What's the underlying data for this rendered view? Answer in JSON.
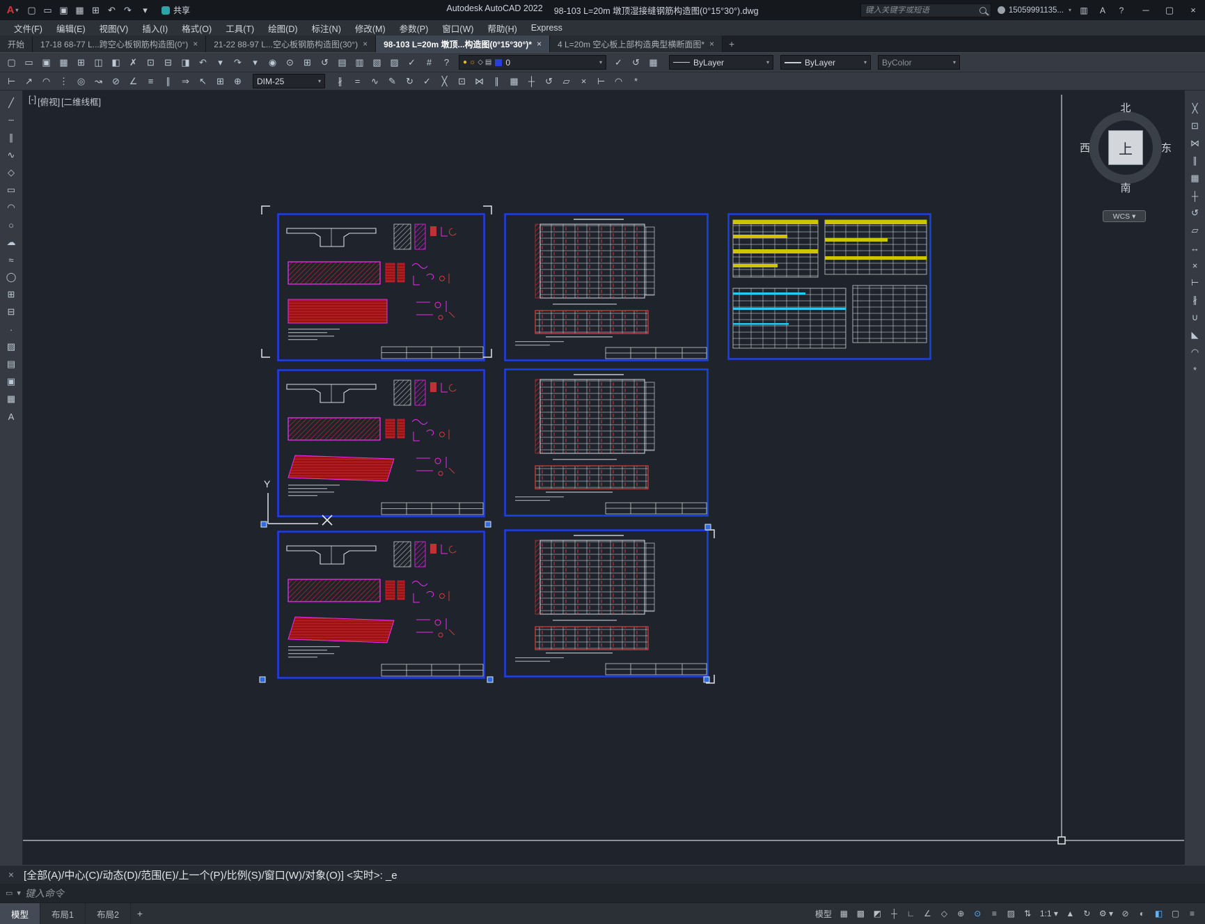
{
  "ui": {
    "caret": "▾"
  },
  "titlebar": {
    "app_title": "Autodesk AutoCAD 2022",
    "doc_title": "98-103 L=20m 墩顶湿接缝钢筋构造图(0°15°30°).dwg",
    "search_placeholder": "键入关键字或短语",
    "user_id": "15059991135...",
    "share_label": "共享",
    "qat_icons": [
      {
        "name": "qnew-icon",
        "glyph": "▢"
      },
      {
        "name": "open-icon",
        "glyph": "▭"
      },
      {
        "name": "save-icon",
        "glyph": "▣"
      },
      {
        "name": "save-as-icon",
        "glyph": "▦"
      },
      {
        "name": "plot-icon",
        "glyph": "⊞"
      },
      {
        "name": "undo-icon",
        "glyph": "↶"
      },
      {
        "name": "redo-icon",
        "glyph": "↷"
      }
    ],
    "qat_overflow_glyph": "▾",
    "right_icons": [
      {
        "name": "app-store-icon",
        "glyph": "▥"
      },
      {
        "name": "autodesk-account-icon",
        "glyph": "A"
      },
      {
        "name": "help-icon",
        "glyph": "?"
      }
    ],
    "window": {
      "minimize": "─",
      "maximize": "▢",
      "close": "×"
    }
  },
  "menubar": {
    "items": [
      {
        "name": "menu-file",
        "label": "文件(F)"
      },
      {
        "name": "menu-edit",
        "label": "编辑(E)"
      },
      {
        "name": "menu-view",
        "label": "视图(V)"
      },
      {
        "name": "menu-insert",
        "label": "插入(I)"
      },
      {
        "name": "menu-format",
        "label": "格式(O)"
      },
      {
        "name": "menu-tools",
        "label": "工具(T)"
      },
      {
        "name": "menu-draw",
        "label": "绘图(D)"
      },
      {
        "name": "menu-dimension",
        "label": "标注(N)"
      },
      {
        "name": "menu-modify",
        "label": "修改(M)"
      },
      {
        "name": "menu-parametric",
        "label": "参数(P)"
      },
      {
        "name": "menu-window",
        "label": "窗口(W)"
      },
      {
        "name": "menu-help",
        "label": "帮助(H)"
      },
      {
        "name": "menu-express",
        "label": "Express"
      }
    ]
  },
  "filetabs": {
    "close_glyph": "×",
    "new_tab_glyph": "+",
    "tabs": [
      {
        "name": "tab-start",
        "label": "开始",
        "closable": false,
        "active": false
      },
      {
        "name": "tab-drawing-1",
        "label": "17-18 68-77 L...跨空心板钢筋构造图(0°)",
        "closable": true,
        "active": false
      },
      {
        "name": "tab-drawing-2",
        "label": "21-22 88-97 L...空心板钢筋构造图(30°)",
        "closable": true,
        "active": false
      },
      {
        "name": "tab-drawing-3",
        "label": "98-103 L=20m 墩顶...构造图(0°15°30°)*",
        "closable": true,
        "active": true
      },
      {
        "name": "tab-drawing-4",
        "label": "4 L=20m 空心板上部构造典型横断面图*",
        "closable": true,
        "active": false
      }
    ]
  },
  "toolbar1": {
    "icons_left": [
      {
        "name": "qnew-icon",
        "glyph": "▢"
      },
      {
        "name": "open-icon",
        "glyph": "▭"
      },
      {
        "name": "save-icon",
        "glyph": "▣"
      },
      {
        "name": "save-as-icon",
        "glyph": "▦"
      },
      {
        "name": "plot-icon",
        "glyph": "⊞"
      },
      {
        "name": "plot-preview-icon",
        "glyph": "◫"
      },
      {
        "name": "publish-icon",
        "glyph": "◧"
      },
      {
        "name": "cut-icon",
        "glyph": "✗"
      },
      {
        "name": "copy-clip-icon",
        "glyph": "⊡"
      },
      {
        "name": "paste-icon",
        "glyph": "⊟"
      },
      {
        "name": "match-properties-icon",
        "glyph": "◨"
      },
      {
        "name": "undo-icon",
        "glyph": "↶"
      },
      {
        "name": "undo-list-icon",
        "glyph": "▾"
      },
      {
        "name": "redo-icon",
        "glyph": "↷"
      },
      {
        "name": "redo-list-icon",
        "glyph": "▾"
      },
      {
        "name": "pan-icon",
        "glyph": "◉"
      },
      {
        "name": "zoom-realtime-icon",
        "glyph": "⊙"
      },
      {
        "name": "zoom-window-icon",
        "glyph": "⊞"
      },
      {
        "name": "zoom-previous-icon",
        "glyph": "↺"
      },
      {
        "name": "properties-icon",
        "glyph": "▤"
      },
      {
        "name": "design-center-icon",
        "glyph": "▥"
      },
      {
        "name": "tool-palettes-icon",
        "glyph": "▧"
      },
      {
        "name": "sheet-set-icon",
        "glyph": "▨"
      },
      {
        "name": "markup-set-icon",
        "glyph": "✓"
      },
      {
        "name": "quick-calc-icon",
        "glyph": "#"
      },
      {
        "name": "help-icon",
        "glyph": "?"
      }
    ],
    "layer_combo": {
      "value": "0",
      "swatch_color": "#2640d8",
      "icons": [
        {
          "name": "layer-on-icon",
          "glyph": "●",
          "color": "#e3c21b"
        },
        {
          "name": "layer-freeze-icon",
          "glyph": "☼",
          "color": "#e3a11b"
        },
        {
          "name": "layer-lock-icon",
          "glyph": "◇",
          "color": "#b9c0c8"
        },
        {
          "name": "layer-plot-icon",
          "glyph": "▤",
          "color": "#b9c0c8"
        }
      ]
    },
    "icons_mid": [
      {
        "name": "layer-make-current-icon",
        "glyph": "✓"
      },
      {
        "name": "layer-previous-icon",
        "glyph": "↺"
      },
      {
        "name": "layer-states-icon",
        "glyph": "▦"
      }
    ],
    "linetype_value": "ByLayer",
    "lineweight_value": "ByLayer",
    "plotstyle_value": "ByColor"
  },
  "toolbar2": {
    "icons_left": [
      {
        "name": "dim-linear-icon",
        "glyph": "⊢"
      },
      {
        "name": "dim-aligned-icon",
        "glyph": "↗"
      },
      {
        "name": "dim-arc-length-icon",
        "glyph": "◠"
      },
      {
        "name": "dim-ordinate-icon",
        "glyph": "⋮"
      },
      {
        "name": "dim-radius-icon",
        "glyph": "◎"
      },
      {
        "name": "dim-jogged-icon",
        "glyph": "↝"
      },
      {
        "name": "dim-diameter-icon",
        "glyph": "⊘"
      },
      {
        "name": "dim-angular-icon",
        "glyph": "∠"
      },
      {
        "name": "quick-dim-icon",
        "glyph": "≡"
      },
      {
        "name": "dim-baseline-icon",
        "glyph": "∥"
      },
      {
        "name": "dim-continue-icon",
        "glyph": "⇒"
      },
      {
        "name": "multileader-icon",
        "glyph": "↖"
      },
      {
        "name": "tolerance-icon",
        "glyph": "⊞"
      },
      {
        "name": "center-mark-icon",
        "glyph": "⊕"
      }
    ],
    "dimstyle_value": "DIM-25",
    "icons_right": [
      {
        "name": "dim-break-icon",
        "glyph": "∦"
      },
      {
        "name": "dim-space-icon",
        "glyph": "="
      },
      {
        "name": "dim-jog-line-icon",
        "glyph": "∿"
      },
      {
        "name": "dim-text-edit-icon",
        "glyph": "✎"
      },
      {
        "name": "dim-update-icon",
        "glyph": "↻"
      },
      {
        "name": "dim-inspect-icon",
        "glyph": "✓"
      },
      {
        "name": "erase-icon",
        "glyph": "╳"
      },
      {
        "name": "copy-icon",
        "glyph": "⊡"
      },
      {
        "name": "mirror-icon",
        "glyph": "⋈"
      },
      {
        "name": "offset-icon",
        "glyph": "∥"
      },
      {
        "name": "array-icon",
        "glyph": "▦"
      },
      {
        "name": "move-icon",
        "glyph": "┼"
      },
      {
        "name": "rotate-icon",
        "glyph": "↺"
      },
      {
        "name": "scale-icon",
        "glyph": "▱"
      },
      {
        "name": "trim-icon",
        "glyph": "×"
      },
      {
        "name": "extend-icon",
        "glyph": "⊢"
      },
      {
        "name": "fillet-icon",
        "glyph": "◠"
      },
      {
        "name": "explode-icon",
        "glyph": "*"
      }
    ]
  },
  "leftbar": {
    "icons": [
      {
        "name": "line-icon",
        "glyph": "╱"
      },
      {
        "name": "construction-line-icon",
        "glyph": "┄"
      },
      {
        "name": "multiline-icon",
        "glyph": "∥"
      },
      {
        "name": "polyline-icon",
        "glyph": "∿"
      },
      {
        "name": "polygon-icon",
        "glyph": "◇"
      },
      {
        "name": "rectangle-icon",
        "glyph": "▭"
      },
      {
        "name": "arc-icon",
        "glyph": "◠"
      },
      {
        "name": "circle-icon",
        "glyph": "○"
      },
      {
        "name": "revision-cloud-icon",
        "glyph": "☁"
      },
      {
        "name": "spline-icon",
        "glyph": "≈"
      },
      {
        "name": "ellipse-icon",
        "glyph": "◯"
      },
      {
        "name": "insert-block-icon",
        "glyph": "⊞"
      },
      {
        "name": "make-block-icon",
        "glyph": "⊟"
      },
      {
        "name": "point-icon",
        "glyph": "∙"
      },
      {
        "name": "hatch-icon",
        "glyph": "▨"
      },
      {
        "name": "gradient-icon",
        "glyph": "▤"
      },
      {
        "name": "region-icon",
        "glyph": "▣"
      },
      {
        "name": "table-icon",
        "glyph": "▦"
      },
      {
        "name": "multi-text-icon",
        "glyph": "A"
      }
    ]
  },
  "rightbar": {
    "icons": [
      {
        "name": "erase-icon",
        "glyph": "╳"
      },
      {
        "name": "copy-icon",
        "glyph": "⊡"
      },
      {
        "name": "mirror-icon",
        "glyph": "⋈"
      },
      {
        "name": "offset-icon",
        "glyph": "∥"
      },
      {
        "name": "array-icon",
        "glyph": "▦"
      },
      {
        "name": "move-icon",
        "glyph": "┼"
      },
      {
        "name": "rotate-icon",
        "glyph": "↺"
      },
      {
        "name": "scale-icon",
        "glyph": "▱"
      },
      {
        "name": "stretch-icon",
        "glyph": "↔"
      },
      {
        "name": "trim-icon",
        "glyph": "×"
      },
      {
        "name": "extend-icon",
        "glyph": "⊢"
      },
      {
        "name": "break-icon",
        "glyph": "∦"
      },
      {
        "name": "join-icon",
        "glyph": "∪"
      },
      {
        "name": "chamfer-icon",
        "glyph": "◣"
      },
      {
        "name": "fillet-icon",
        "glyph": "◠"
      },
      {
        "name": "explode-icon",
        "glyph": "*"
      }
    ]
  },
  "canvas": {
    "viewport_controls": {
      "minimize": "[-]",
      "view": "[俯视]",
      "visual_style": "[二维线框]"
    },
    "compass": {
      "north": "北",
      "south": "南",
      "east": "东",
      "west": "西",
      "top": "上",
      "wcs_label": "WCS ▾"
    },
    "ucs_y_label": "Y",
    "sheet_border_color": "#1d3fe0",
    "rebar_red": "#d42a2a",
    "outline_magenta": "#f02bf0",
    "highlight_yellow": "#cfc400",
    "highlight_cyan": "#25c9f2"
  },
  "commandline": {
    "close_glyph": "×",
    "history": "[全部(A)/中心(C)/动态(D)/范围(E)/上一个(P)/比例(S)/窗口(W)/对象(O)] <实时>: _e",
    "icon_glyph": "▭",
    "customize_glyph": "▾",
    "input_placeholder": "键入命令"
  },
  "bottombar": {
    "tabs": [
      {
        "name": "model-tab",
        "label": "模型",
        "active": true
      },
      {
        "name": "layout1-tab",
        "label": "布局1",
        "active": false
      },
      {
        "name": "layout2-tab",
        "label": "布局2",
        "active": false
      }
    ],
    "new_layout_glyph": "+",
    "status_icons": [
      {
        "name": "model-space-button",
        "glyph": "模型"
      },
      {
        "name": "grid-icon",
        "glyph": "▦"
      },
      {
        "name": "snap-mode-icon",
        "glyph": "▩"
      },
      {
        "name": "infer-constraints-icon",
        "glyph": "◩"
      },
      {
        "name": "dynamic-input-icon",
        "glyph": "┼"
      },
      {
        "name": "ortho-icon",
        "glyph": "∟"
      },
      {
        "name": "polar-tracking-icon",
        "glyph": "∠"
      },
      {
        "name": "isodraft-icon",
        "glyph": "◇"
      },
      {
        "name": "object-snap-tracking-icon",
        "glyph": "⊕"
      },
      {
        "name": "object-snap-icon",
        "glyph": "⊙",
        "active": true
      },
      {
        "name": "lineweight-icon",
        "glyph": "≡"
      },
      {
        "name": "transparency-icon",
        "glyph": "▨"
      },
      {
        "name": "selection-cycling-icon",
        "glyph": "⇅"
      },
      {
        "name": "annotation-scale-button",
        "glyph": "1:1 ▾"
      },
      {
        "name": "annotation-visibility-icon",
        "glyph": "▲"
      },
      {
        "name": "autoscale-icon",
        "glyph": "↻"
      },
      {
        "name": "workspace-switching-icon",
        "glyph": "⚙ ▾"
      },
      {
        "name": "annotation-monitor-icon",
        "glyph": "⊘"
      },
      {
        "name": "object-isolate-icon",
        "glyph": "◐"
      },
      {
        "name": "graphics-performance-icon",
        "glyph": "◧",
        "active": true
      },
      {
        "name": "clean-screen-icon",
        "glyph": "▢"
      },
      {
        "name": "customization-icon",
        "glyph": "≡"
      }
    ]
  }
}
